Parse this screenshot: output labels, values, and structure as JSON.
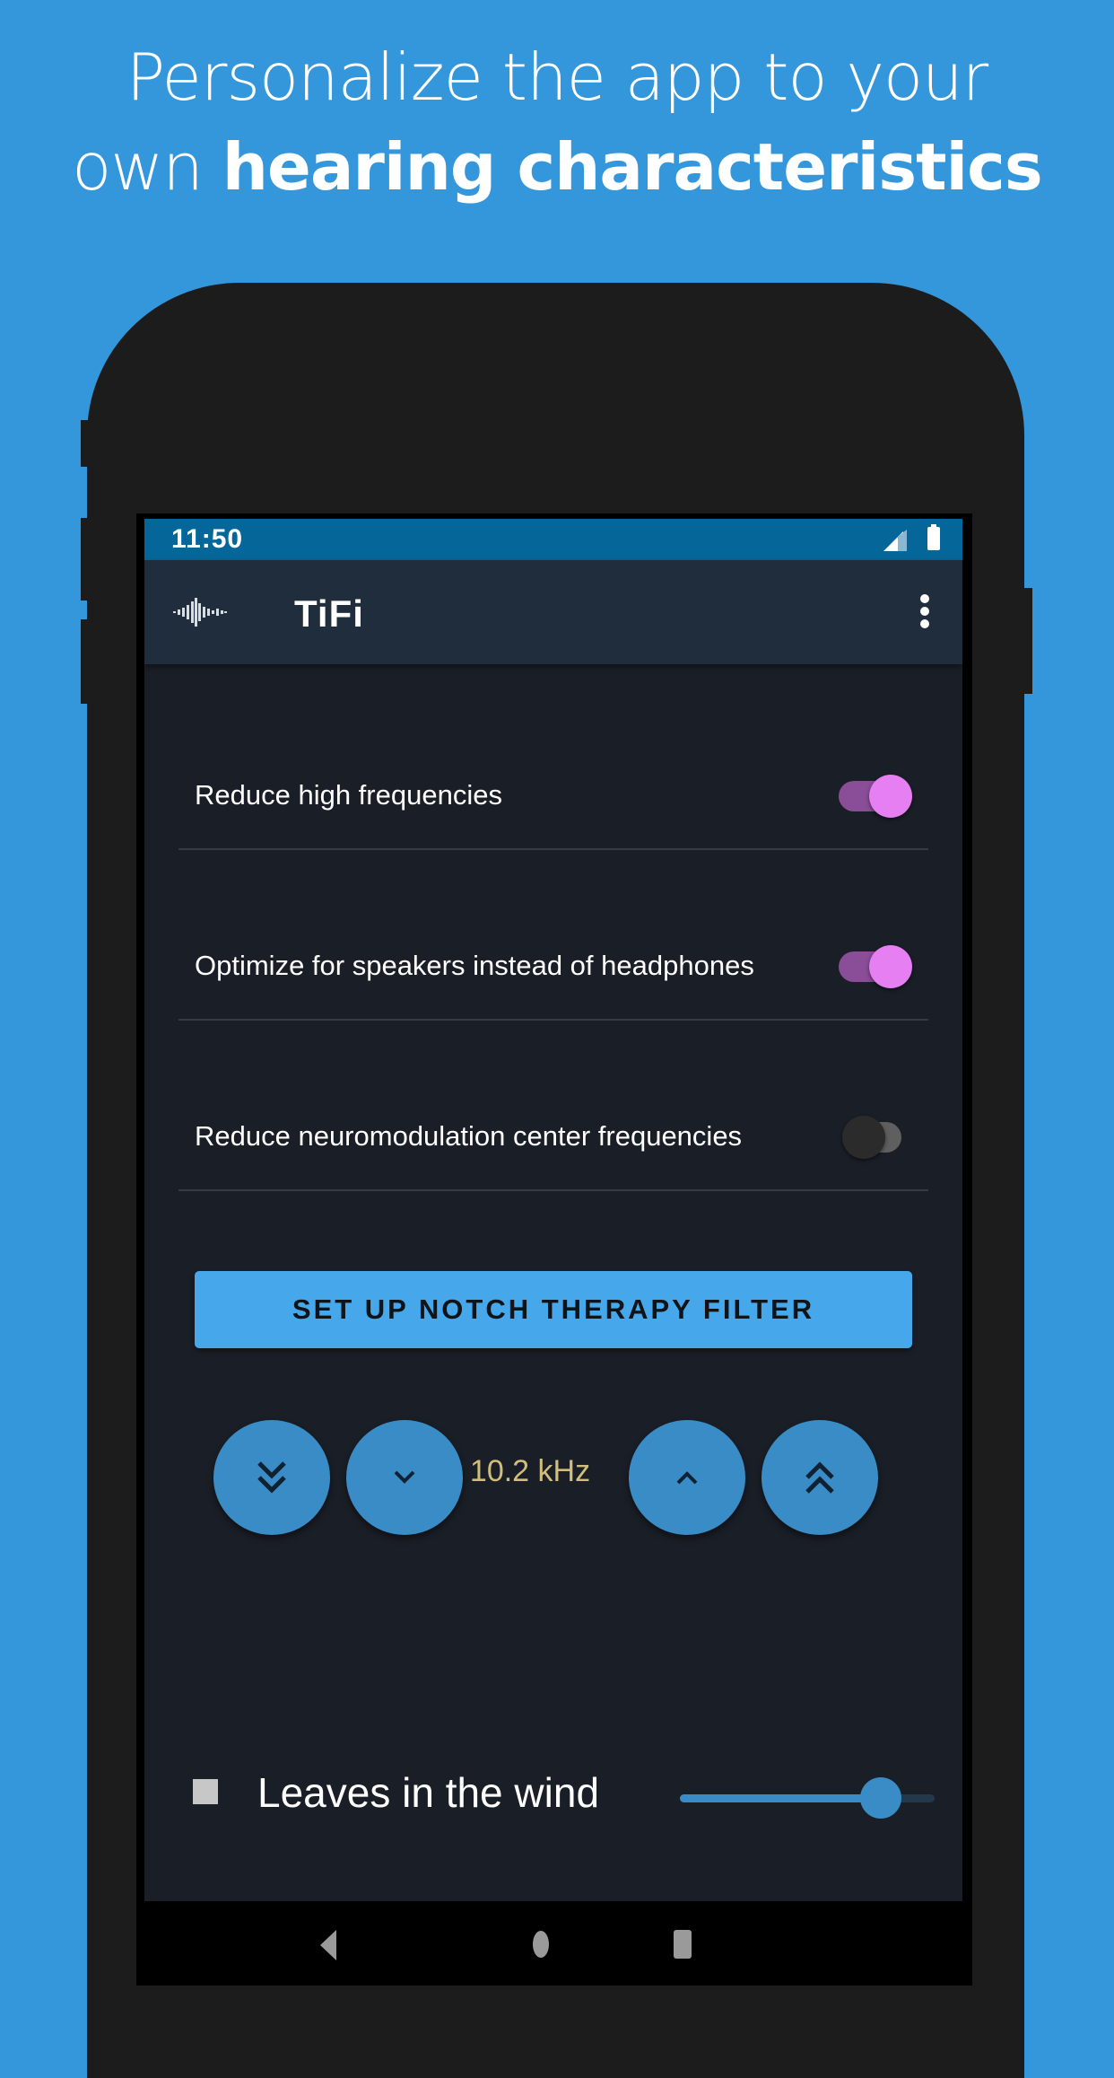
{
  "promo": {
    "headline_line1": "Personalize the app to your",
    "headline_line2_light": "own ",
    "headline_line2_bold": "hearing characteristics"
  },
  "status_bar": {
    "time": "11:50",
    "icons": [
      "signal-icon",
      "battery-icon"
    ]
  },
  "app_bar": {
    "logo_icon": "waveform-icon",
    "title": "TiFi",
    "menu_icon": "more-vert-icon"
  },
  "settings": [
    {
      "label": "Reduce high frequencies",
      "enabled": true
    },
    {
      "label": "Optimize for speakers instead of headphones",
      "enabled": true
    },
    {
      "label": "Reduce neuromodulation center frequencies",
      "enabled": false
    }
  ],
  "notch_button": {
    "label": "SET UP NOTCH THERAPY FILTER"
  },
  "frequency_control": {
    "value": "10.2 kHz",
    "buttons": [
      {
        "name": "decrease-large",
        "icon": "double-chevron-down-icon"
      },
      {
        "name": "decrease-small",
        "icon": "chevron-down-icon"
      },
      {
        "name": "increase-small",
        "icon": "chevron-up-icon"
      },
      {
        "name": "increase-large",
        "icon": "double-chevron-up-icon"
      }
    ]
  },
  "sound": {
    "name": "Leaves in the wind",
    "stop_icon": "stop-icon",
    "volume_fraction": 0.79
  },
  "nav_bar": {
    "icons": [
      "back-icon",
      "home-icon",
      "recents-icon"
    ]
  },
  "colors": {
    "background": "#3597db",
    "status_bar": "#056799",
    "app_bar": "#1f2d3c",
    "screen_bg": "#1a1e26",
    "switch_on": "#e57ff2",
    "accent_button": "#46a8ea",
    "fab": "#3a8cc6",
    "frequency_text": "#d2be7c"
  }
}
